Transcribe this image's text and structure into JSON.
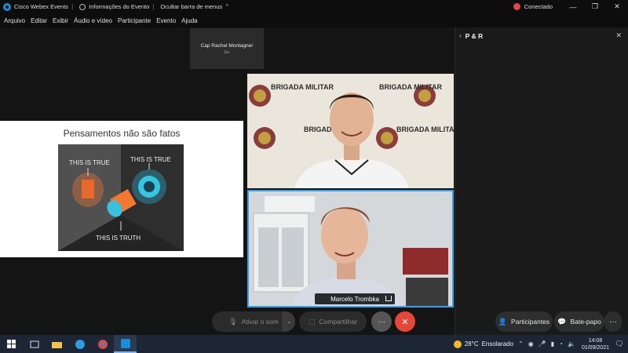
{
  "titlebar": {
    "app_name": "Cisco Webex Events",
    "event_info": "Informações do Evento",
    "hide_menu": "Ocultar barra de menus",
    "status": "Conectado",
    "minimize": "—",
    "maximize": "❐",
    "close": "✕"
  },
  "menu": {
    "items": [
      "Arquivo",
      "Editar",
      "Exibir",
      "Áudio e vídeo",
      "Participante",
      "Evento",
      "Ajuda"
    ]
  },
  "stage": {
    "presenter_name": "Cap Rachel Montagner",
    "presenter_sub": "Eu",
    "slide_title": "Pensamentos não são fatos",
    "slide_label_left": "THIS IS TRUE",
    "slide_label_right": "THIS IS TRUE",
    "slide_label_bottom": "THIS IS TRUTH",
    "badge_text": "BRIGADA MILITAR",
    "video2_name": "Marcelo Trombka"
  },
  "panel": {
    "title": "P & R",
    "chevron": "›",
    "close": "✕"
  },
  "controls": {
    "mute": "Ativar o som",
    "share": "Compartilhar",
    "more": "···",
    "leave": "✕",
    "participants": "Participantes",
    "chat": "Bate-papo",
    "more2": "···"
  },
  "taskbar": {
    "weather_temp": "28°C",
    "weather_text": "Ensolarado",
    "time": "14:08",
    "date": "01/09/2021"
  },
  "colors": {
    "accent": "#3aa0e8",
    "leave": "#e5473b",
    "status_dot": "#e04848"
  }
}
